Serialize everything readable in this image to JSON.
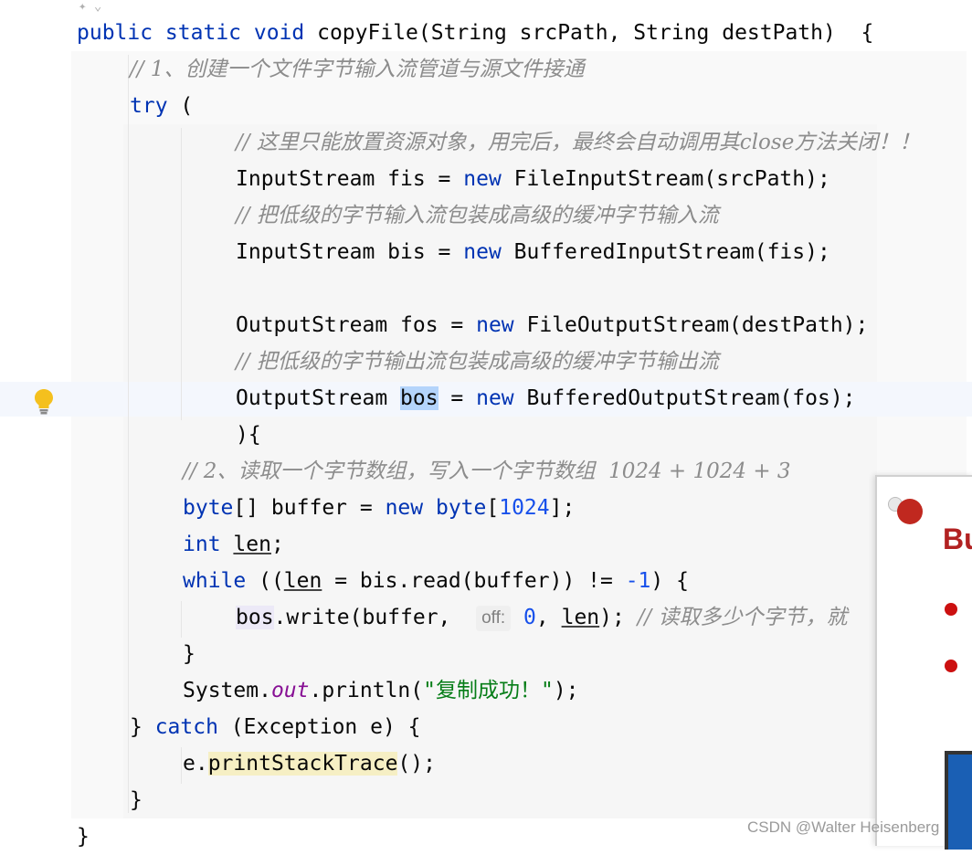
{
  "colors": {
    "keyword": "#0033b3",
    "comment": "#8c8c8c",
    "string": "#067d17",
    "number": "#1750eb",
    "selection": "#b4d4fb",
    "slide_accent": "#b22222"
  },
  "icons": {
    "gutter_intention": "lightbulb-icon",
    "top_fragment": "sparkle-icon"
  },
  "editor": {
    "hint_off": "off:",
    "lines": {
      "l1": {
        "a": "public static void ",
        "b": "copyFile(String srcPath, String destPath)  {"
      },
      "l2": {
        "cmt": "// 1、创建一个文件字节输入流管道与源文件接通"
      },
      "l3": {
        "kw": "try",
        "rest": " ("
      },
      "l4": {
        "cmt": "// 这里只能放置资源对象，用完后，最终会自动调用其close方法关闭！！"
      },
      "l5": {
        "a": "InputStream fis = ",
        "kw": "new",
        "b": " FileInputStream(srcPath);"
      },
      "l6": {
        "cmt": "// 把低级的字节输入流包装成高级的缓冲字节输入流"
      },
      "l7": {
        "a": "InputStream bis = ",
        "kw": "new",
        "b": " BufferedInputStream(fis);"
      },
      "l8": {
        "a": "OutputStream fos = ",
        "kw": "new",
        "b": " FileOutputStream(destPath);"
      },
      "l9": {
        "cmt": "// 把低级的字节输出流包装成高级的缓冲字节输出流"
      },
      "l10": {
        "a": "OutputStream ",
        "sel": "bos",
        "b": " = ",
        "kw": "new",
        "c": " BufferedOutputStream(fos);"
      },
      "l11": {
        "a": "){"
      },
      "l12": {
        "cmt": "// 2、读取一个字节数组，写入一个字节数组  1024 + 1024 + 3"
      },
      "l13": {
        "kw1": "byte",
        "a": "[] buffer = ",
        "kw2": "new",
        "b": " ",
        "kw3": "byte",
        "c": "[",
        "num": "1024",
        "d": "];"
      },
      "l14": {
        "kw": "int",
        "a": " ",
        "var": "len",
        "b": ";"
      },
      "l15": {
        "kw": "while",
        "a": " ((",
        "var": "len",
        "b": " = bis.read(buffer)) != ",
        "num": "-1",
        "c": ") {"
      },
      "l16": {
        "ref": "bos",
        "a": ".write(buffer,  ",
        "num": "0",
        "b": ", ",
        "var": "len",
        "c": "); ",
        "cmt": "// 读取多少个字节，就"
      },
      "l17": {
        "a": "}"
      },
      "l18": {
        "a": "System.",
        "field": "out",
        "b": ".println(",
        "str": "\"复制成功！\"",
        "c": ");"
      },
      "l19": {
        "a": "} ",
        "kw": "catch",
        "b": " (Exception e) {"
      },
      "l20": {
        "a": "e.",
        "warn": "printStackTrace",
        "b": "();"
      },
      "l21": {
        "a": "}"
      },
      "l22": {
        "a": "}"
      }
    }
  },
  "slide": {
    "title_fragment": "Bu"
  },
  "watermark": "CSDN @Walter Heisenberg"
}
